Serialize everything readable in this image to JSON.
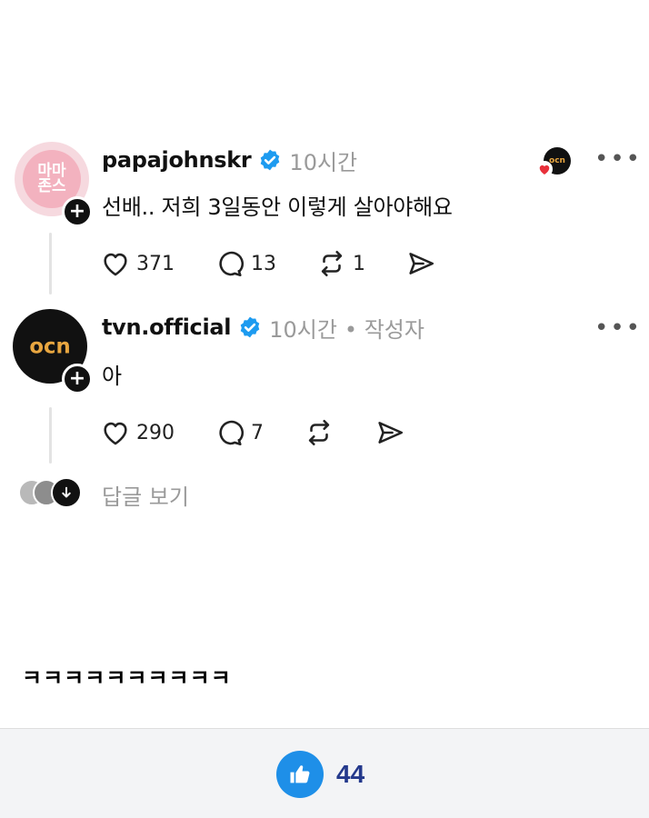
{
  "posts": [
    {
      "username": "papajohnskr",
      "time": "10시간",
      "author_tag": "",
      "text": "선배.. 저희 3일동안 이렇게 살아야해요",
      "avatar_text_top": "마마",
      "avatar_text_bottom": "존스",
      "avatar_bg": "#f3b2bf",
      "likes": "371",
      "comments": "13",
      "reposts": "1",
      "liked_by_icon": "ocn-avatar-with-heart"
    },
    {
      "username": "tvn.official",
      "time": "10시간",
      "author_tag": "• 작성자",
      "text": "아",
      "avatar_logo": "ocn",
      "avatar_bg": "#111111",
      "likes": "290",
      "comments": "7",
      "reposts": ""
    }
  ],
  "replies": {
    "label": "답글 보기"
  },
  "caption": "ㅋㅋㅋㅋㅋㅋㅋㅋㅋㅋ",
  "footer": {
    "like_count": "44"
  },
  "colors": {
    "verified": "#1d9bf0",
    "muted_text": "#9a9a9a",
    "like_button": "#1e8fe8",
    "like_count": "#24398c",
    "footer_bg": "#f3f4f6"
  },
  "icons": {
    "more": "more-horizontal-icon",
    "like": "heart-icon",
    "comment": "comment-bubble-icon",
    "repost": "repost-icon",
    "share": "send-icon"
  }
}
